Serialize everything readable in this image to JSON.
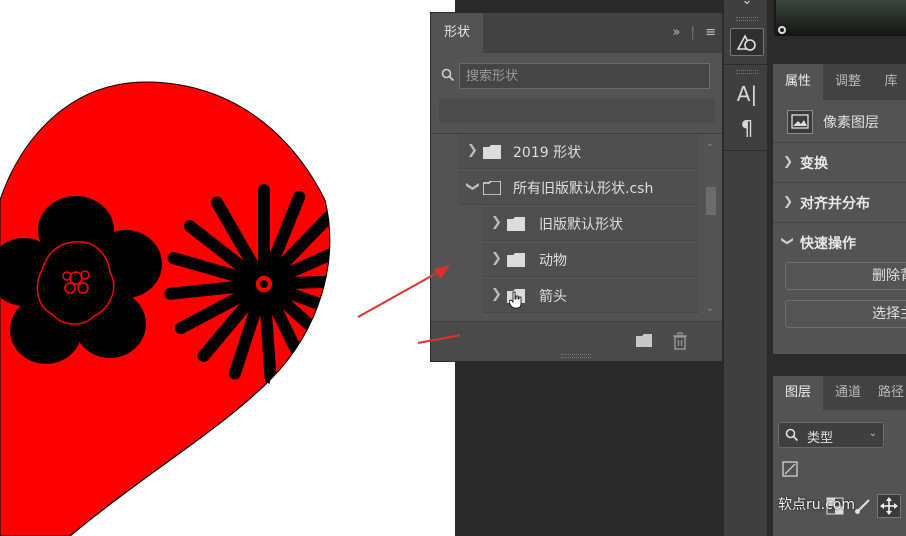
{
  "shapes_panel": {
    "tab_title": "形状",
    "search": {
      "placeholder": "搜索形状",
      "value": ""
    },
    "tree": [
      {
        "label": "2019 形状",
        "level": 0,
        "expanded": false
      },
      {
        "label": "所有旧版默认形状.csh",
        "level": 0,
        "expanded": true
      },
      {
        "label": "旧版默认形状",
        "level": 1,
        "expanded": false
      },
      {
        "label": "动物",
        "level": 1,
        "expanded": false
      },
      {
        "label": "箭头",
        "level": 1,
        "expanded": false
      }
    ]
  },
  "properties_panel": {
    "tabs": [
      "属性",
      "调整",
      "库"
    ],
    "active_tab": "属性",
    "layer_type": "像素图层",
    "sections": [
      "变换",
      "对齐并分布",
      "快速操作"
    ],
    "quick_actions": [
      "删除背",
      "选择主"
    ]
  },
  "layers_panel": {
    "tabs": [
      "图层",
      "通道",
      "路径"
    ],
    "active_tab": "图层",
    "filter_label": "类型"
  },
  "watermark": "软点ru.com",
  "colors": {
    "canvas_shape": "#ff0000",
    "flower": "#000000",
    "panel_bg": "#535353",
    "annotation_arrow": "#e0302a"
  }
}
